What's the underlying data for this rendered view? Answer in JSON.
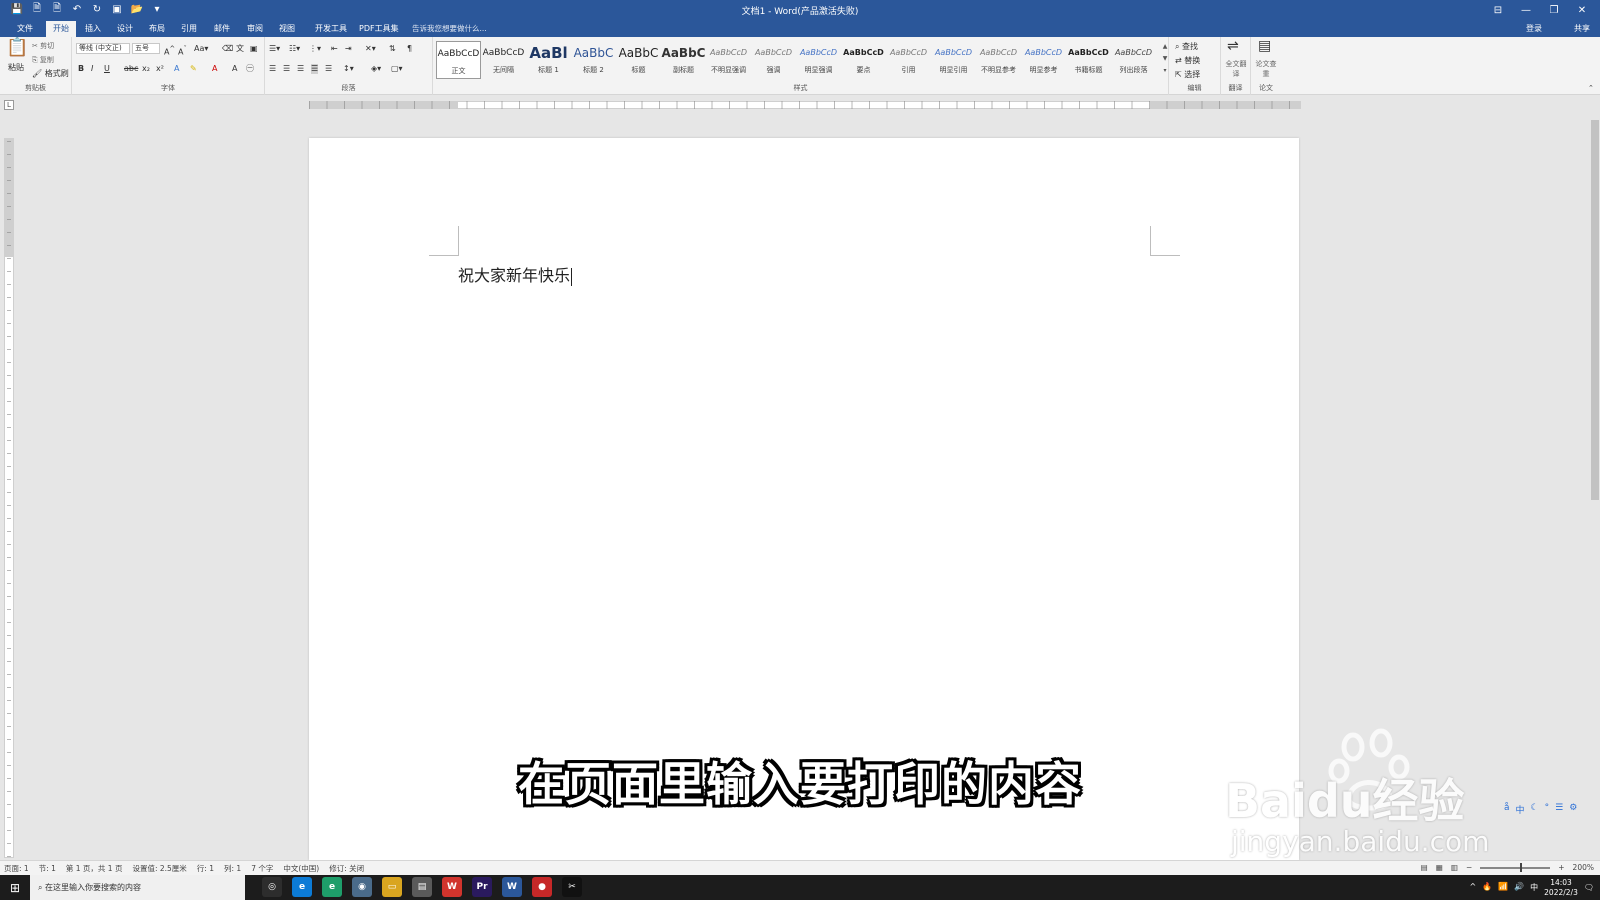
{
  "window": {
    "title": "文档1 - Word(产品激活失败)",
    "controls": [
      "⊟",
      "—",
      "❐",
      "✕"
    ]
  },
  "qat": [
    "💾",
    "🗎",
    "🗎",
    "↶",
    "↻",
    "▣",
    "📂",
    "▾"
  ],
  "tabs": [
    "文件",
    "开始",
    "插入",
    "设计",
    "布局",
    "引用",
    "邮件",
    "审阅",
    "视图",
    "开发工具",
    "PDF工具集"
  ],
  "active_tab": "开始",
  "tell_me": "告诉我您想要做什么...",
  "signin": "登录",
  "share": "共享",
  "ribbon": {
    "clipboard": {
      "label": "剪贴板",
      "paste": "粘贴",
      "cut": "剪切",
      "copy": "复制",
      "format_painter": "格式刷"
    },
    "font": {
      "label": "字体",
      "font_name": "等线 (中文正)",
      "font_size": "五号",
      "bold": "B",
      "italic": "I",
      "underline": "U",
      "strike": "abc",
      "sub": "x₂",
      "sup": "x²"
    },
    "paragraph": {
      "label": "段落"
    },
    "styles": {
      "label": "样式",
      "items": [
        {
          "preview": "AaBbCcD",
          "name": "正文"
        },
        {
          "preview": "AaBbCcD",
          "name": "无间隔"
        },
        {
          "preview": "AaBl",
          "name": "标题 1"
        },
        {
          "preview": "AaBbC",
          "name": "标题 2"
        },
        {
          "preview": "AaBbC",
          "name": "标题"
        },
        {
          "preview": "AaBbC",
          "name": "副标题"
        },
        {
          "preview": "AaBbCcD",
          "name": "不明显强调"
        },
        {
          "preview": "AaBbCcD",
          "name": "强调"
        },
        {
          "preview": "AaBbCcD",
          "name": "明显强调"
        },
        {
          "preview": "AaBbCcD",
          "name": "要点"
        },
        {
          "preview": "AaBbCcD",
          "name": "引用"
        },
        {
          "preview": "AaBbCcD",
          "name": "明显引用"
        },
        {
          "preview": "AaBbCcD",
          "name": "不明显参考"
        },
        {
          "preview": "AaBbCcD",
          "name": "明显参考"
        },
        {
          "preview": "AaBbCcD",
          "name": "书籍标题"
        },
        {
          "preview": "AaBbCcD",
          "name": "列出段落"
        }
      ]
    },
    "editing": {
      "label": "编辑",
      "find": "查找",
      "replace": "替换",
      "select": "选择"
    },
    "translate": {
      "label": "翻译",
      "full": "全文翻译"
    },
    "paper": {
      "label": "论文",
      "check": "论文查重"
    }
  },
  "document": {
    "text": "祝大家新年快乐"
  },
  "subtitle": "在页面里输入要打印的内容",
  "watermark": {
    "brand": "Baidu经验",
    "url": "jingyan.baidu.com"
  },
  "ime": [
    "å",
    "中",
    "☾",
    "°",
    "☰",
    "⚙"
  ],
  "status": {
    "items": [
      "页面: 1",
      "节: 1",
      "第 1 页，共 1 页",
      "设置值: 2.5厘米",
      "行: 1",
      "列: 1",
      "7 个字",
      "中文(中国)",
      "修订: 关闭"
    ],
    "zoom": "200%"
  },
  "taskbar": {
    "search_placeholder": "在这里输入你要搜索的内容",
    "apps": [
      {
        "name": "cortana",
        "glyph": "◎",
        "color": "#2d2d2d"
      },
      {
        "name": "edge",
        "glyph": "e",
        "color": "#0c7bd6"
      },
      {
        "name": "edge-beta",
        "glyph": "e",
        "color": "#1e9e6a"
      },
      {
        "name": "browser",
        "glyph": "◉",
        "color": "#4a6b8a"
      },
      {
        "name": "explorer",
        "glyph": "▭",
        "color": "#d9a520"
      },
      {
        "name": "app",
        "glyph": "▤",
        "color": "#5a5a5a"
      },
      {
        "name": "wps",
        "glyph": "W",
        "color": "#d1342d"
      },
      {
        "name": "premiere",
        "glyph": "Pr",
        "color": "#2a1a5e"
      },
      {
        "name": "word",
        "glyph": "W",
        "color": "#2b579a"
      },
      {
        "name": "recorder",
        "glyph": "●",
        "color": "#c62828"
      },
      {
        "name": "capcut",
        "glyph": "✂",
        "color": "#111111"
      }
    ],
    "tray": [
      "^",
      "🔥",
      "📶",
      "🔊",
      "中"
    ],
    "time": "14:03",
    "date": "2022/2/3"
  }
}
